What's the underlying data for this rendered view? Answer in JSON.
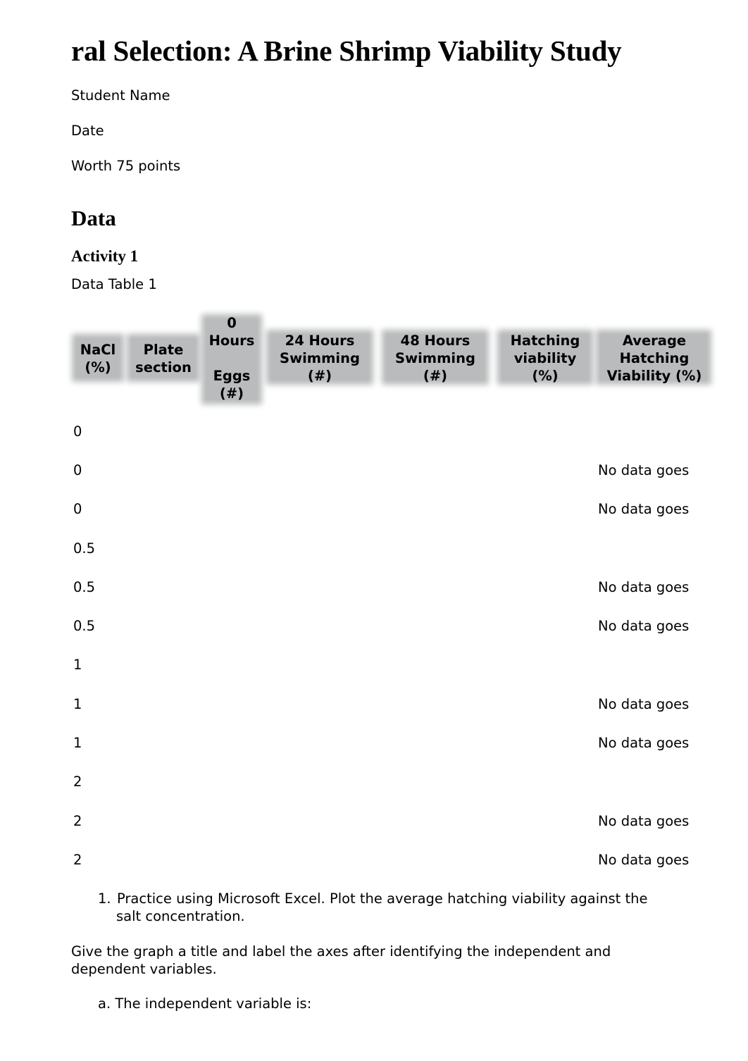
{
  "document": {
    "title": "ral Selection: A Brine Shrimp Viability Study",
    "student_name_label": "Student Name",
    "date_label": "Date",
    "worth_label": "Worth 75 points",
    "section_heading": "Data",
    "activity_heading": "Activity 1",
    "table_caption": "Data Table 1"
  },
  "table": {
    "headers": [
      "NaCl\n(%)",
      "Plate\nsection",
      "0\nHours\n\nEggs\n(#)",
      "24 Hours\nSwimming\n(#)",
      "48 Hours\nSwimming\n(#)",
      "Hatching\nviability\n(%)",
      "Average\nHatching\nViability (%)"
    ],
    "rows": [
      {
        "nacl": "0",
        "average_note": ""
      },
      {
        "nacl": "0",
        "average_note": "No data goes"
      },
      {
        "nacl": "0",
        "average_note": "No data goes"
      },
      {
        "nacl": "0.5",
        "average_note": ""
      },
      {
        "nacl": "0.5",
        "average_note": "No data goes"
      },
      {
        "nacl": "0.5",
        "average_note": "No data goes"
      },
      {
        "nacl": "1",
        "average_note": ""
      },
      {
        "nacl": "1",
        "average_note": "No data goes"
      },
      {
        "nacl": "1",
        "average_note": "No data goes"
      },
      {
        "nacl": "2",
        "average_note": ""
      },
      {
        "nacl": "2",
        "average_note": "No data goes"
      },
      {
        "nacl": "2",
        "average_note": "No data goes"
      }
    ]
  },
  "questions": {
    "q1_number": "1.",
    "q1_line1": "Practice using Microsoft Excel. Plot the average hatching viability against the",
    "q1_line2": "salt concentration.",
    "instruction_line1": "Give the graph a title and label the axes after identifying the independent and",
    "instruction_line2": "dependent variables.",
    "qa_label": "a. The independent variable is:"
  },
  "colors": {
    "header_fill": "#b9bbbc",
    "text": "#000000"
  }
}
